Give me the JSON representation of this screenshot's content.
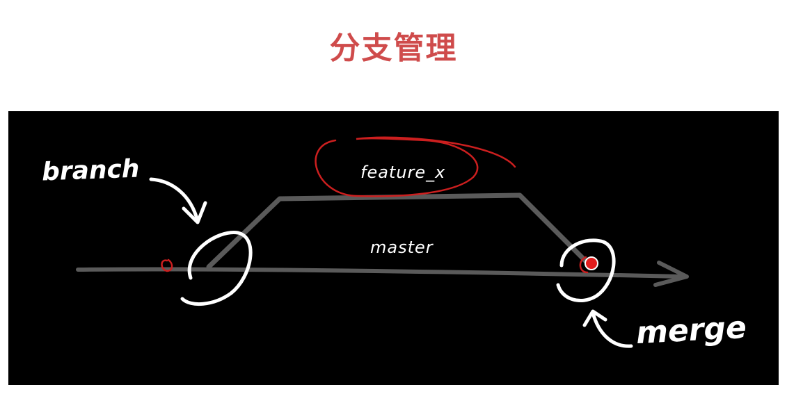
{
  "title": "分支管理",
  "diagram": {
    "labels": {
      "branch": "branch",
      "feature": "feature_x",
      "master": "master",
      "merge": "merge"
    },
    "colors": {
      "title": "#cf4b4b",
      "background": "#000000",
      "line": "#5a5a5a",
      "ink": "#ffffff",
      "highlight": "#cc1f1f"
    }
  }
}
